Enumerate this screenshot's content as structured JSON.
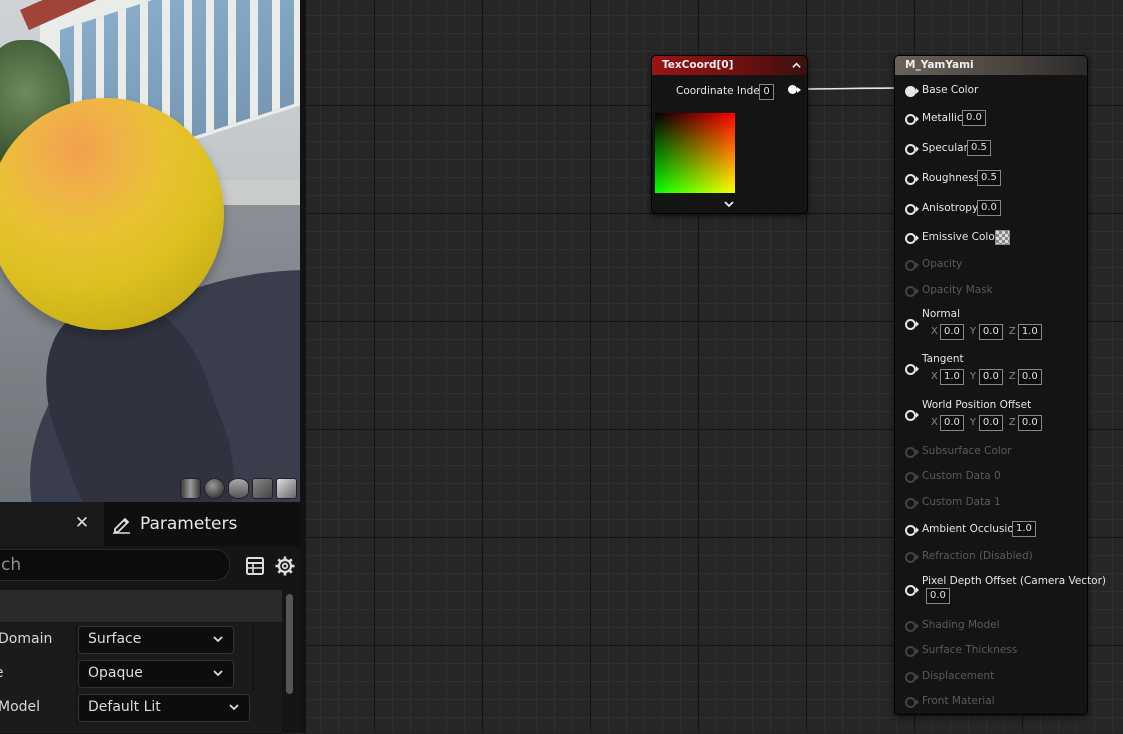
{
  "details_panel": {
    "tab_details_label": "s",
    "tab_close_glyph": "✕",
    "tab_parameters_label": "Parameters",
    "search_text": "ch",
    "rows": [
      {
        "label": "Domain",
        "value": "Surface"
      },
      {
        "label": "de",
        "value": "Opaque"
      },
      {
        "label": "Model",
        "value": "Default Lit"
      }
    ]
  },
  "texcoord_node": {
    "title": "TexCoord[0]",
    "coordinate_index_label": "Coordinate Index",
    "coordinate_index_value": "0"
  },
  "material_node": {
    "title": "M_YamYami",
    "inputs": {
      "base_color": "Base Color",
      "metallic": "Metallic",
      "metallic_value": "0.0",
      "specular": "Specular",
      "specular_value": "0.5",
      "roughness": "Roughness",
      "roughness_value": "0.5",
      "anisotropy": "Anisotropy",
      "anisotropy_value": "0.0",
      "emissive_color": "Emissive Color",
      "opacity": "Opacity",
      "opacity_mask": "Opacity Mask",
      "normal": "Normal",
      "normal_x": "0.0",
      "normal_y": "0.0",
      "normal_z": "1.0",
      "tangent": "Tangent",
      "tangent_x": "1.0",
      "tangent_y": "0.0",
      "tangent_z": "0.0",
      "wpo": "World Position Offset",
      "wpo_x": "0.0",
      "wpo_y": "0.0",
      "wpo_z": "0.0",
      "subsurface_color": "Subsurface Color",
      "custom_data_0": "Custom Data 0",
      "custom_data_1": "Custom Data 1",
      "ambient_occlusion": "Ambient Occlusion",
      "ambient_occlusion_value": "1.0",
      "refraction": "Refraction (Disabled)",
      "pixel_depth_offset": "Pixel Depth Offset (Camera Vector)",
      "pixel_depth_offset_value": "0.0",
      "shading_model": "Shading Model",
      "surface_thickness": "Surface Thickness",
      "displacement": "Displacement",
      "front_material": "Front Material"
    },
    "axis_x": "X",
    "axis_y": "Y",
    "axis_z": "Z"
  },
  "colors": {
    "texcoord_header": "#9a1414",
    "material_header": "#6a6258",
    "graph_background": "#262626"
  }
}
